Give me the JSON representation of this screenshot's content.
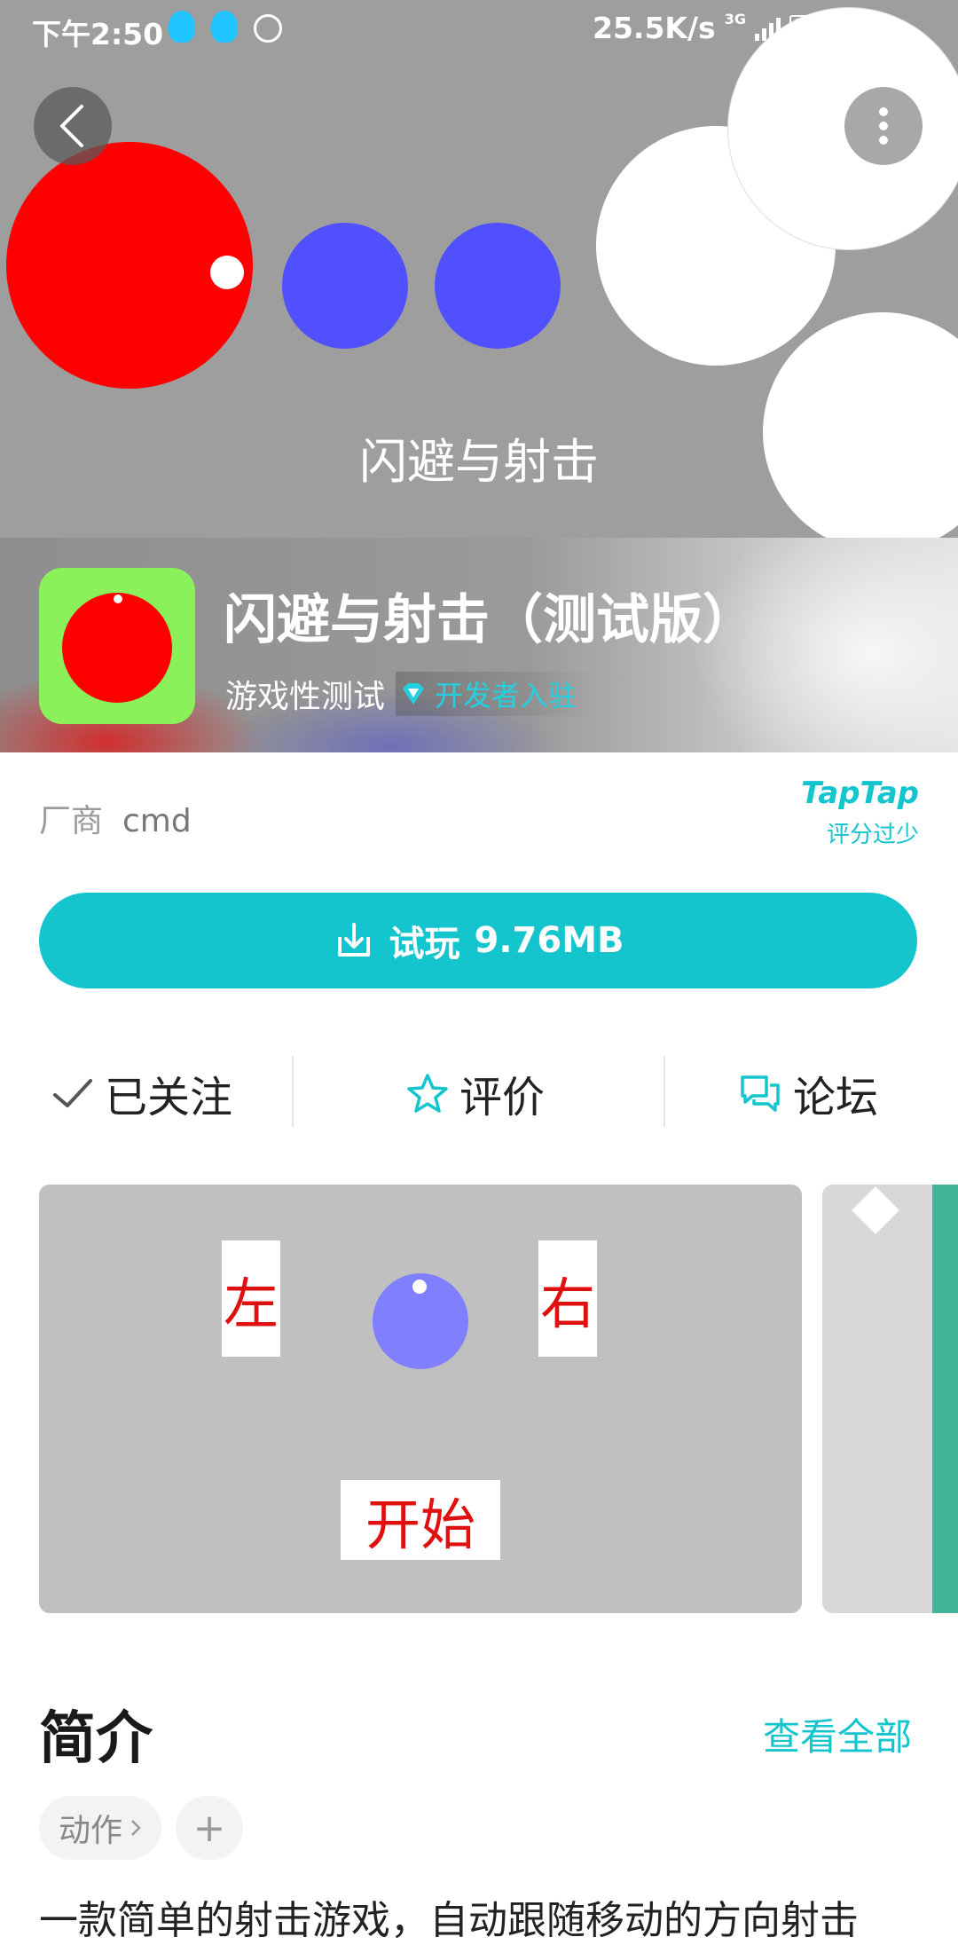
{
  "status_bar": {
    "time": "下午2:50",
    "network_speed": "25.5K/s",
    "network_type": "3G",
    "hd_label": "HD",
    "icons": [
      "qq-icon",
      "qq-icon",
      "timer-icon",
      "signal-icon",
      "hd-icon",
      "battery-icon"
    ]
  },
  "hero": {
    "title": "闪避与射击",
    "colors": {
      "background": "#9e9e9e",
      "player": "#ff0000",
      "enemy": "#5050ff",
      "obstacle": "#ffffff"
    }
  },
  "app": {
    "name": "闪避与射击（测试版）",
    "developer": "游戏性测试",
    "badge": "开发者入驻",
    "icon_colors": {
      "background": "#8bf15a",
      "ball": "#ff0000"
    }
  },
  "info": {
    "vendor_label": "厂商",
    "vendor_value": "cmd",
    "rating_brand": "TapTap",
    "rating_note": "评分过少"
  },
  "download": {
    "label": "试玩",
    "size": "9.76MB",
    "color": "#15c5ce"
  },
  "actions": {
    "follow": "已关注",
    "review": "评价",
    "forum": "论坛"
  },
  "screenshot": {
    "left": "左",
    "right": "右",
    "start": "开始"
  },
  "intro": {
    "title": "简介",
    "view_all": "查看全部",
    "tags": [
      "动作"
    ],
    "add_tag": "+",
    "text": "一款简单的射击游戏，自动跟随移动的方向射击"
  }
}
